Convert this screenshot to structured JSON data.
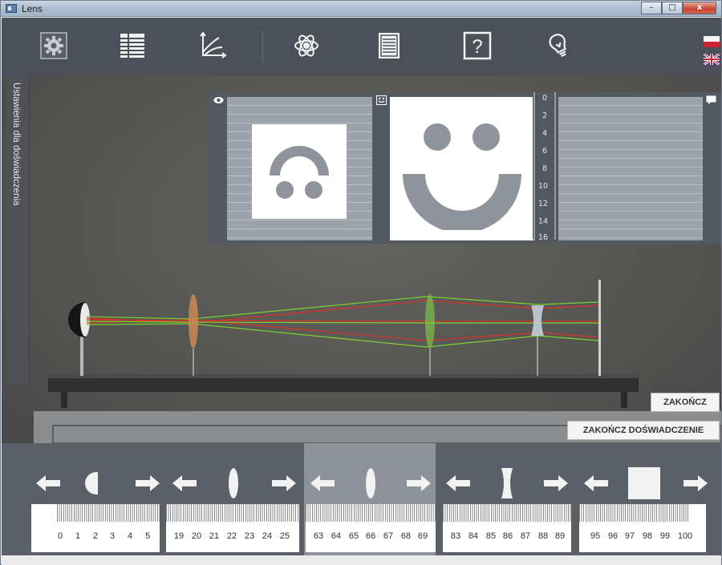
{
  "window": {
    "title": "Lens",
    "minimize": "–",
    "maximize": "□",
    "close": "x"
  },
  "toolbar": {
    "icons": [
      "gear-icon",
      "table-icon",
      "graph-axes-icon",
      "atom-icon",
      "document-icon",
      "help-icon",
      "lightbulb-icon"
    ],
    "help_label": "?"
  },
  "side_tab": {
    "label": "Ustawienia dla doświadczenia"
  },
  "vertical_ruler": {
    "ticks": [
      "0",
      "2",
      "4",
      "6",
      "8",
      "10",
      "12",
      "14",
      "16"
    ]
  },
  "buttons": {
    "finish": "ZAKOŃCZ",
    "finish_experiment": "ZAKOŃCZ DOŚWIADCZENIE"
  },
  "controls": [
    {
      "name": "light-source",
      "ticks": [
        "0",
        "1",
        "2",
        "3",
        "4",
        "5"
      ],
      "active": false
    },
    {
      "name": "lens-1",
      "ticks": [
        "19",
        "20",
        "21",
        "22",
        "23",
        "24",
        "25"
      ],
      "active": false
    },
    {
      "name": "lens-2",
      "ticks": [
        "63",
        "64",
        "65",
        "66",
        "67",
        "68",
        "69"
      ],
      "active": true
    },
    {
      "name": "diverging-lens",
      "ticks": [
        "83",
        "84",
        "85",
        "86",
        "87",
        "88",
        "89"
      ],
      "active": false
    },
    {
      "name": "screen",
      "ticks": [
        "95",
        "96",
        "97",
        "98",
        "99",
        "100"
      ],
      "active": false
    }
  ],
  "colors": {
    "ray_red": "#d8322a",
    "ray_green": "#7bd12f",
    "accent_flag_red": "#d42034",
    "toolbar_bg": "#4c5059"
  }
}
